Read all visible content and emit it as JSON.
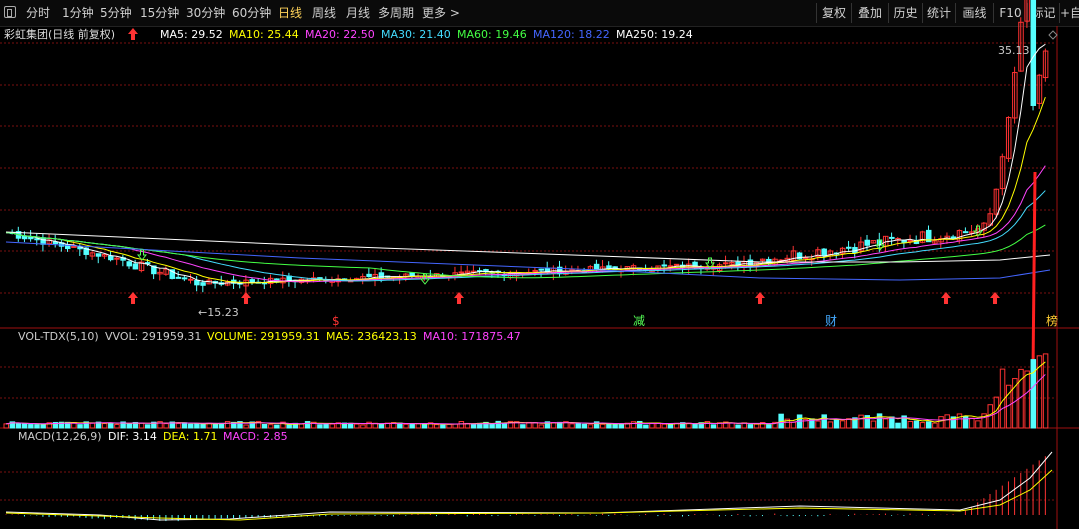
{
  "toolbar": {
    "periods": [
      "分时",
      "1分钟",
      "5分钟",
      "15分钟",
      "30分钟",
      "60分钟",
      "日线",
      "周线",
      "月线",
      "多周期",
      "更多 >"
    ],
    "active_period": "日线",
    "right_buttons": [
      "复权",
      "叠加",
      "历史",
      "统计",
      "画线",
      "F10",
      "标记",
      "+自"
    ]
  },
  "stock": {
    "title": "彩虹集团(日线 前复权)"
  },
  "ma_legend": [
    {
      "label": "MA5: 29.52",
      "color": "#ffffff"
    },
    {
      "label": "MA10: 25.44",
      "color": "#ffff00"
    },
    {
      "label": "MA20: 22.50",
      "color": "#ff44ff"
    },
    {
      "label": "MA30: 21.40",
      "color": "#44ddff"
    },
    {
      "label": "MA60: 19.46",
      "color": "#44ff44"
    },
    {
      "label": "MA120: 18.22",
      "color": "#4466ff"
    },
    {
      "label": "MA250: 19.24",
      "color": "#ffffff"
    }
  ],
  "vol_legend": [
    {
      "label": "VOL-TDX(5,10)",
      "color": "#cccccc"
    },
    {
      "label": "VVOL: 291959.31",
      "color": "#cccccc"
    },
    {
      "label": "VOLUME: 291959.31",
      "color": "#ffff00"
    },
    {
      "label": "MA5: 236423.13",
      "color": "#ffff00"
    },
    {
      "label": "MA10: 171875.47",
      "color": "#ff44ff"
    }
  ],
  "macd_legend": [
    {
      "label": "MACD(12,26,9)",
      "color": "#cccccc"
    },
    {
      "label": "DIF: 3.14",
      "color": "#ffffff"
    },
    {
      "label": "DEA: 1.71",
      "color": "#ffff00"
    },
    {
      "label": "MACD: 2.85",
      "color": "#ff44ff"
    }
  ],
  "annotations": {
    "high_label": "35.13",
    "low_label": "←15.23"
  },
  "markers": [
    {
      "char": "$",
      "color": "#ff3333"
    },
    {
      "char": "减",
      "color": "#55ff55"
    },
    {
      "char": "财",
      "color": "#44aaff"
    },
    {
      "char": "榜",
      "color": "#ffcc33"
    }
  ],
  "colors": {
    "up": "#ff3333",
    "down": "#55ffff",
    "grid": "#7a1010",
    "bg": "#000000"
  }
}
